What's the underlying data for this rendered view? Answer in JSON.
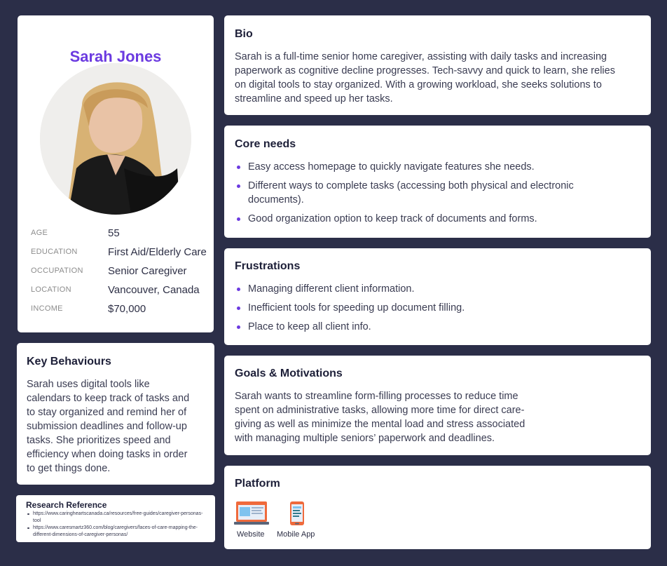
{
  "profile": {
    "name": "Sarah Jones",
    "attributes": [
      {
        "key": "AGE",
        "value": "55"
      },
      {
        "key": "EDUCATION",
        "value": "First Aid/Elderly Care"
      },
      {
        "key": "OCCUPATION",
        "value": "Senior Caregiver"
      },
      {
        "key": "LOCATION",
        "value": "Vancouver, Canada"
      },
      {
        "key": "INCOME",
        "value": "$70,000"
      }
    ]
  },
  "key_behaviours": {
    "title": "Key Behaviours",
    "lines": [
      "Sarah uses digital tools like",
      "calendars to keep track of tasks and",
      "to stay organized and remind her of",
      "submission deadlines and follow-up",
      "tasks. She prioritizes speed and",
      "efficiency when doing tasks in order",
      "to get things done."
    ]
  },
  "research": {
    "title": "Research Reference",
    "items": [
      "https://www.caringheartscanada.ca/resources/free-guides/caregiver-personas-tool",
      "https://www.caresmartz360.com/blog/caregivers/faces-of-care-mapping-the-different-dimensions-of-caregiver-personas/"
    ]
  },
  "bio": {
    "title": "Bio",
    "lines": [
      "Sarah is a full-time senior home caregiver, assisting with daily tasks and increasing",
      "paperwork as cognitive decline progresses. Tech-savvy and quick to learn, she relies",
      "on digital tools to stay organized. With a growing workload, she seeks solutions to",
      "streamline and speed up her tasks."
    ]
  },
  "core_needs": {
    "title": "Core needs",
    "items": [
      "Easy access homepage to quickly navigate features she needs.",
      "Different ways to complete tasks (accessing both physical and electronic documents).",
      "Good organization option to keep track of documents and forms."
    ]
  },
  "frustrations": {
    "title": "Frustrations",
    "items": [
      "Managing different client information.",
      "Inefficient tools for speeding up document filling.",
      "Place to keep all client info."
    ]
  },
  "goals": {
    "title": "Goals & Motivations",
    "lines": [
      "Sarah wants to streamline form-filling processes to reduce time",
      "spent on administrative tasks, allowing more time for direct care-",
      "giving   as well as minimize the mental load and stress associated",
      "with managing multiple seniors’ paperwork and deadlines."
    ]
  },
  "platform": {
    "title": "Platform",
    "items": [
      {
        "label": "Website",
        "icon": "laptop-icon"
      },
      {
        "label": "Mobile App",
        "icon": "smartphone-icon"
      }
    ]
  },
  "colors": {
    "background": "#2b2e48",
    "accent": "#6b3ae0",
    "card": "#ffffff"
  }
}
